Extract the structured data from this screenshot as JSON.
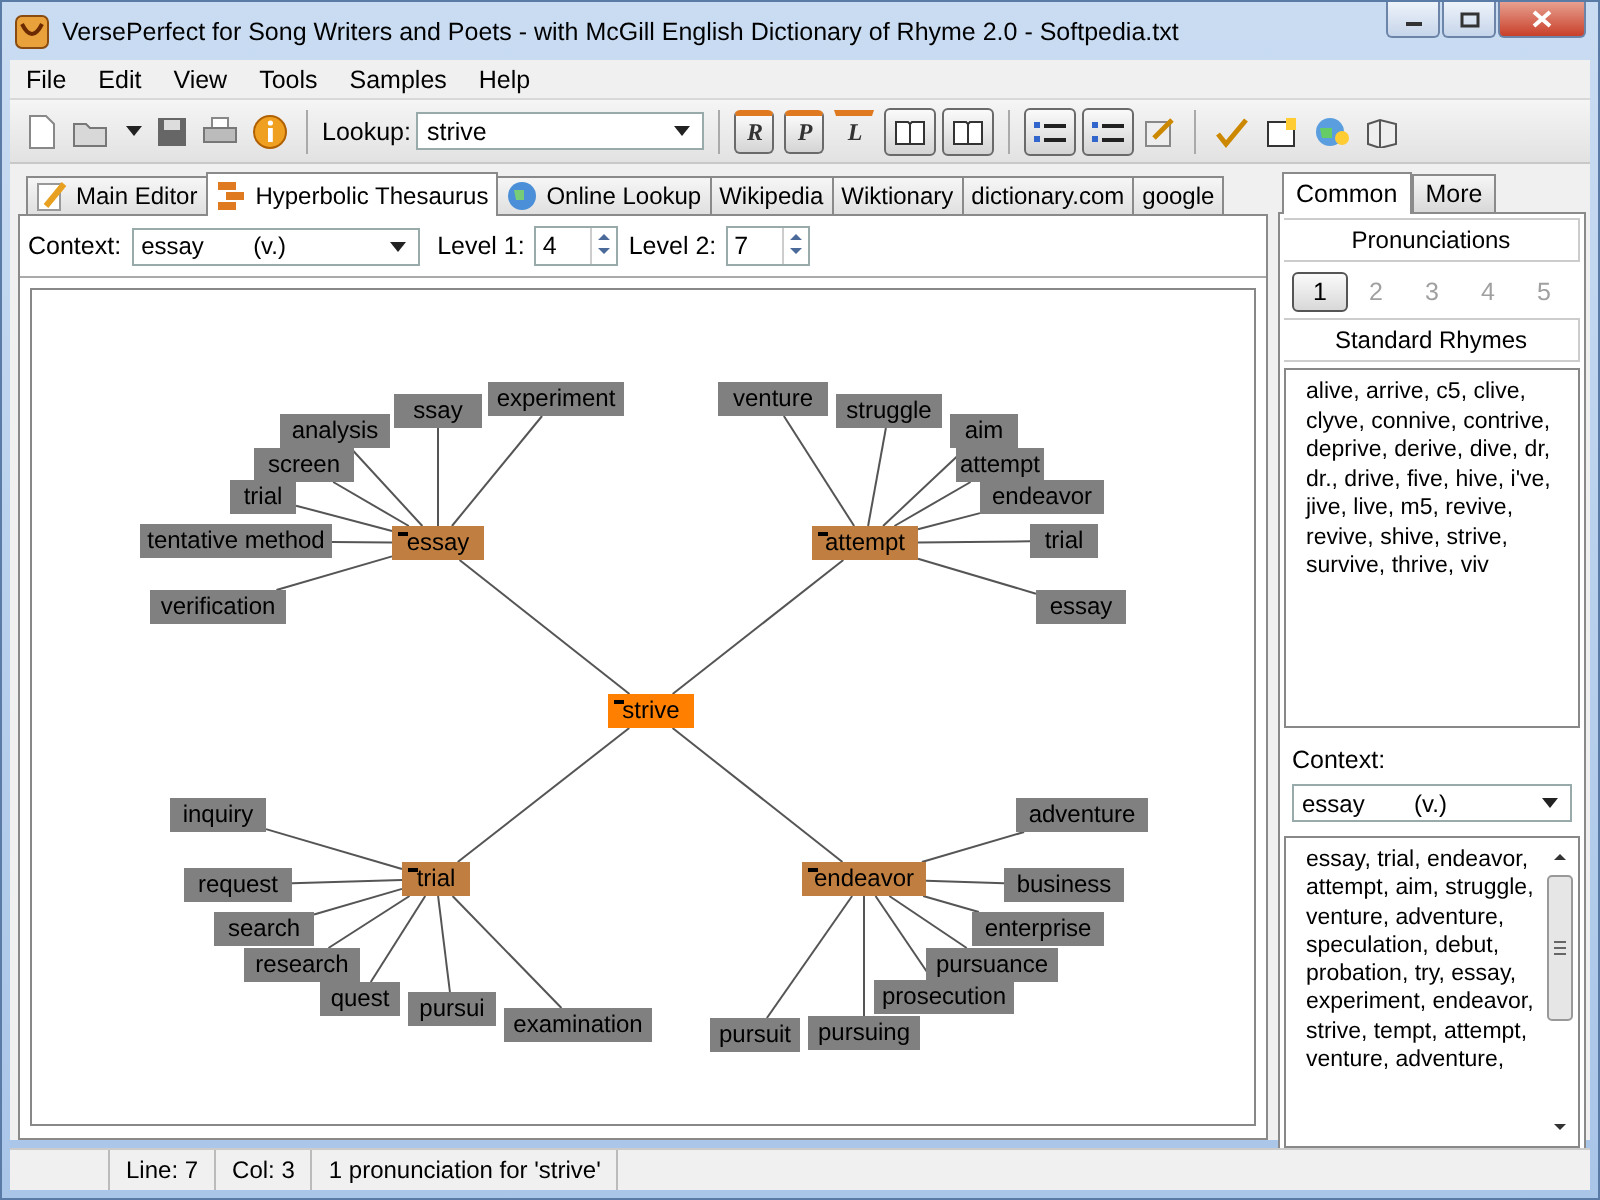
{
  "window": {
    "title": "VersePerfect for Song Writers and Poets - with McGill English Dictionary of Rhyme 2.0 - Softpedia.txt"
  },
  "menu": [
    "File",
    "Edit",
    "View",
    "Tools",
    "Samples",
    "Help"
  ],
  "toolbar": {
    "lookup_label": "Lookup:",
    "lookup_value": "strive",
    "letter_buttons": [
      {
        "label": "R",
        "pressed": true
      },
      {
        "label": "P",
        "pressed": true
      },
      {
        "label": "L",
        "pressed": false
      }
    ],
    "book_buttons": [
      {
        "pressed": true
      },
      {
        "pressed": true
      }
    ],
    "list_buttons": [
      {
        "pressed": true
      },
      {
        "pressed": true
      }
    ]
  },
  "tabs": [
    {
      "label": "Main Editor",
      "selected": false
    },
    {
      "label": "Hyperbolic Thesaurus",
      "selected": true
    },
    {
      "label": "Online Lookup",
      "selected": false
    },
    {
      "label": "Wikipedia",
      "selected": false
    },
    {
      "label": "Wiktionary",
      "selected": false
    },
    {
      "label": "dictionary.com",
      "selected": false
    },
    {
      "label": "google",
      "selected": false
    }
  ],
  "context_bar": {
    "context_label": "Context:",
    "context_value": "essay",
    "context_pos": "(v.)",
    "level1_label": "Level 1:",
    "level1_value": "4",
    "level2_label": "Level 2:",
    "level2_value": "7"
  },
  "graph": {
    "center": "strive",
    "hubs": [
      {
        "label": "essay",
        "children": [
          "experiment",
          "ssay",
          "analysis",
          "screen",
          "trial",
          "tentative method",
          "verification"
        ]
      },
      {
        "label": "attempt",
        "children": [
          "venture",
          "struggle",
          "aim",
          "attempt",
          "endeavor",
          "trial",
          "essay"
        ]
      },
      {
        "label": "trial",
        "children": [
          "inquiry",
          "request",
          "search",
          "research",
          "quest",
          "pursui",
          "examination"
        ]
      },
      {
        "label": "endeavor",
        "children": [
          "adventure",
          "business",
          "enterprise",
          "pursuance",
          "prosecution",
          "pursuing",
          "pursuit"
        ]
      }
    ]
  },
  "side_panel": {
    "tabs": [
      {
        "label": "Common",
        "selected": true
      },
      {
        "label": "More",
        "selected": false
      }
    ],
    "pronunciations_header": "Pronunciations",
    "pronunciations": [
      {
        "label": "1",
        "selected": true,
        "disabled": false
      },
      {
        "label": "2",
        "selected": false,
        "disabled": true
      },
      {
        "label": "3",
        "selected": false,
        "disabled": true
      },
      {
        "label": "4",
        "selected": false,
        "disabled": true
      },
      {
        "label": "5",
        "selected": false,
        "disabled": true
      }
    ],
    "rhymes_header": "Standard Rhymes",
    "rhymes": "alive, arrive, c5, clive, clyve, connive, contrive, deprive, derive, dive, dr, dr., drive, five, hive, i've, jive, live, m5, revive, revive, shive, strive, survive, thrive, viv",
    "context_label": "Context:",
    "context_value": "essay",
    "context_pos": "(v.)",
    "synonyms": "essay, trial, endeavor, attempt, aim, struggle, venture, adventure, speculation, debut, probation, try, essay, experiment, endeavor, strive, tempt, attempt, venture, adventure,"
  },
  "status_bar": [
    "Line: 7",
    "Col: 3",
    "1 pronunciation for 'strive'"
  ]
}
